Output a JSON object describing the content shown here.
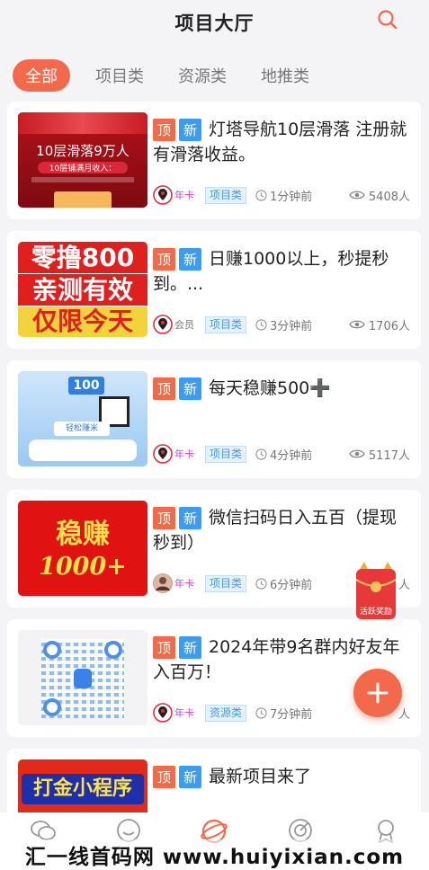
{
  "header": {
    "title": "项目大厅"
  },
  "tabs": [
    {
      "label": "全部"
    },
    {
      "label": "项目类"
    },
    {
      "label": "资源类"
    },
    {
      "label": "地推类"
    }
  ],
  "tag_top": "顶",
  "tag_new": "新",
  "items": [
    {
      "title": "灯塔导航10层滑落 注册就有滑落收益。",
      "thumb_text": [
        "10层滑落9万人",
        "10层铺满月收入："
      ],
      "vip": "年卡",
      "category": "项目类",
      "time": "1分钟前",
      "views": "5408人"
    },
    {
      "title": "日赚1000以上，秒提秒到。...",
      "thumb_text": [
        "零撸800",
        "亲测有效",
        "仅限今天"
      ],
      "vip": "会员",
      "category": "项目类",
      "time": "3分钟前",
      "views": "1706人"
    },
    {
      "title": "每天稳赚500➕",
      "thumb_text": [
        "100",
        "轻松赚米"
      ],
      "vip": "年卡",
      "category": "项目类",
      "time": "4分钟前",
      "views": "5117人"
    },
    {
      "title": "微信扫码日入五百（提现秒到）",
      "thumb_text": [
        "稳赚",
        "1000+"
      ],
      "vip": "年卡",
      "category": "项目类",
      "time": "6分钟前",
      "views": "人"
    },
    {
      "title": "2024年带9名群内好友年入百万！",
      "thumb_text": [],
      "vip": "年卡",
      "category": "资源类",
      "time": "7分钟前",
      "views": "人"
    },
    {
      "title": "最新项目来了",
      "thumb_text": [
        "打金小程序"
      ],
      "vip": "",
      "category": "",
      "time": "",
      "views": ""
    }
  ],
  "float_reward": {
    "label": "活跃奖励"
  },
  "watermark": "汇一线首码网 www.huiyixian.com",
  "colors": {
    "accent": "#f26a4b",
    "blue": "#3e9cf0"
  }
}
